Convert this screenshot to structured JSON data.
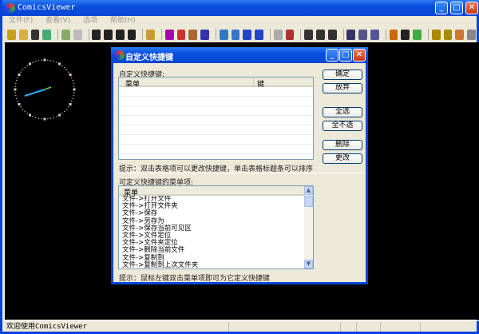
{
  "app": {
    "title": "ComicsViewer"
  },
  "window_controls": {
    "minimize": "_",
    "maximize": "□",
    "close": "✕"
  },
  "menu": [
    "文件(F)",
    "查看(V)",
    "选项",
    "帮助(H)"
  ],
  "toolbar_icons": [
    "open-file-icon",
    "open-folder-icon",
    "save-icon",
    "export-icon",
    "|",
    "bookmark-icon",
    "find-icon",
    "|",
    "first-page-icon",
    "prev-page-icon",
    "next-page-icon",
    "last-page-icon",
    "|",
    "folder-up-icon",
    "|",
    "flip-horizontal-icon",
    "rotate-left-icon",
    "rotate-right-icon",
    "flip-vertical-icon",
    "|",
    "split-h-icon",
    "split-v-icon",
    "fit-width-icon",
    "fit-height-icon",
    "|",
    "double-page-icon",
    "book-icon",
    "|",
    "single-page-icon",
    "fit-page-icon",
    "actual-size-icon",
    "|",
    "zoom-in-icon",
    "window-icon",
    "copy-icon",
    "|",
    "color-icon",
    "page-mode-icon",
    "settings-icon",
    "|",
    "help-icon",
    "about-icon",
    "home-icon",
    "plugin-icon"
  ],
  "status": {
    "text": "欢迎使用ComicsViewer"
  },
  "dialog": {
    "title": "自定义快捷键",
    "shortcut_label": "自定义快捷键:",
    "columns": [
      "菜单",
      "键"
    ],
    "buttons": {
      "ok": "确定",
      "cancel": "放弃",
      "select_all": "全选",
      "select_none": "全不选",
      "delete": "删除",
      "change": "更改"
    },
    "hint1": "提示：双击表格项可以更改快捷键，单击表格标题条可以排序",
    "menu_items_label": "可定义快捷键的菜单项:",
    "list_header": "菜单",
    "items": [
      "文件->打开文件",
      "文件->打开文件夹",
      "文件->保存",
      "文件->另存为",
      "文件->保存当前可见区",
      "文件->文件定位",
      "文件->文件夹定位",
      "文件->删除当前文件",
      "文件->复制到",
      "文件->复制到上次文件夹"
    ],
    "hint2": "提示：鼠标左键双击菜单项即可为它定义快捷键"
  }
}
